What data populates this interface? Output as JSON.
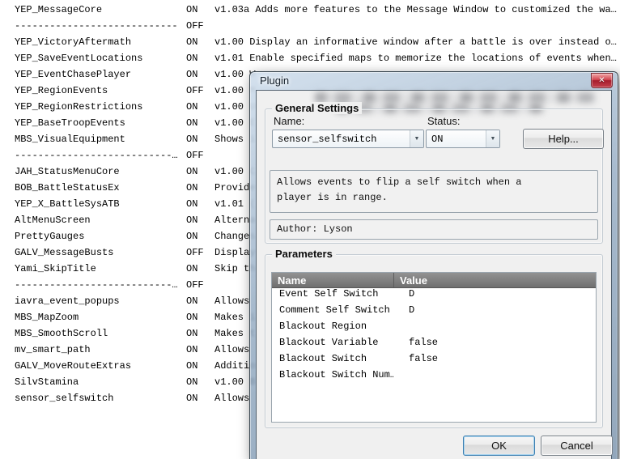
{
  "icons": {
    "close": "✕",
    "dropdown": "▼"
  },
  "plugin_list": {
    "rows": [
      {
        "name": "YEP_MessageCore",
        "status": "ON",
        "desc": "v1.03a Adds more features to the Message Window to customized the wa…"
      },
      {
        "name": "----------------------------",
        "status": "OFF",
        "desc": ""
      },
      {
        "name": "YEP_VictoryAftermath",
        "status": "ON",
        "desc": "v1.00 Display an informative window after a battle is over instead o…"
      },
      {
        "name": "YEP_SaveEventLocations",
        "status": "ON",
        "desc": "v1.01 Enable specified maps to memorize the locations of events when…"
      },
      {
        "name": "YEP_EventChasePlayer",
        "status": "ON",
        "desc": "v1.00 W"
      },
      {
        "name": "YEP_RegionEvents",
        "status": "OFF",
        "desc": "v1.00 M"
      },
      {
        "name": "YEP_RegionRestrictions",
        "status": "ON",
        "desc": "v1.00 U"
      },
      {
        "name": "YEP_BaseTroopEvents",
        "status": "ON",
        "desc": "v1.00 E"
      },
      {
        "name": "MBS_VisualEquipment",
        "status": "ON",
        "desc": "Shows i"
      },
      {
        "name": "---------------------------…",
        "status": "OFF",
        "desc": ""
      },
      {
        "name": "JAH_StatusMenuCore",
        "status": "ON",
        "desc": "v1.00 C"
      },
      {
        "name": "BOB_BattleStatusEx",
        "status": "ON",
        "desc": "Provide"
      },
      {
        "name": "YEP_X_BattleSysATB",
        "status": "ON",
        "desc": "v1.01 ("
      },
      {
        "name": "AltMenuScreen",
        "status": "ON",
        "desc": "Alterna"
      },
      {
        "name": "PrettyGauges",
        "status": "ON",
        "desc": "Changes"
      },
      {
        "name": "GALV_MessageBusts",
        "status": "OFF",
        "desc": "Display"
      },
      {
        "name": "Yami_SkipTitle",
        "status": "ON",
        "desc": "Skip th"
      },
      {
        "name": "---------------------------…",
        "status": "OFF",
        "desc": ""
      },
      {
        "name": "iavra_event_popups",
        "status": "ON",
        "desc": "Allows "
      },
      {
        "name": "MBS_MapZoom",
        "status": "ON",
        "desc": "Makes i"
      },
      {
        "name": "MBS_SmoothScroll",
        "status": "ON",
        "desc": "Makes t"
      },
      {
        "name": "mv_smart_path",
        "status": "ON",
        "desc": "Allows "
      },
      {
        "name": "GALV_MoveRouteExtras",
        "status": "ON",
        "desc": "Additio"
      },
      {
        "name": "SilvStamina",
        "status": "ON",
        "desc": "v1.00 B"
      },
      {
        "name": "sensor_selfswitch",
        "status": "ON",
        "desc": "Allows "
      }
    ]
  },
  "dialog": {
    "title": "Plugin",
    "general": {
      "title": "General Settings",
      "name_label": "Name:",
      "name_value": "sensor_selfswitch",
      "status_label": "Status:",
      "status_value": "ON",
      "help_label": "Help...",
      "description": "Allows events to flip a self switch when a\nplayer is in range.",
      "author": "Author: Lyson"
    },
    "parameters": {
      "title": "Parameters",
      "headers": {
        "name": "Name",
        "value": "Value"
      },
      "rows": [
        {
          "name": "Event Self Switch",
          "value": "D"
        },
        {
          "name": "Comment Self Switch",
          "value": "D"
        },
        {
          "name": "Blackout Region",
          "value": ""
        },
        {
          "name": "Blackout Variable",
          "value": "false"
        },
        {
          "name": "Blackout Switch",
          "value": "false"
        },
        {
          "name": "Blackout Switch Num…",
          "value": ""
        }
      ]
    },
    "buttons": {
      "ok": "OK",
      "cancel": "Cancel"
    }
  }
}
